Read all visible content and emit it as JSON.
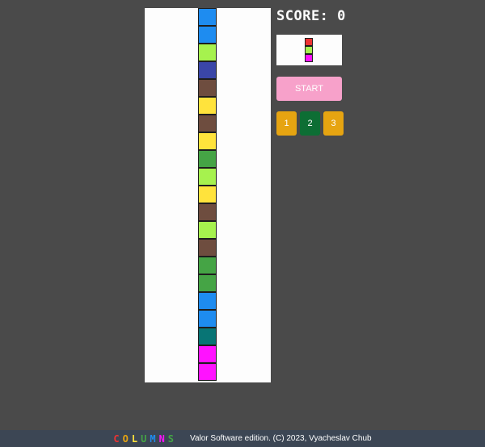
{
  "board": {
    "column": [
      "blue",
      "blue",
      "lime",
      "indigo",
      "brown",
      "yellow",
      "brown",
      "yellow",
      "green",
      "lime",
      "yellow",
      "brown",
      "lime",
      "brown",
      "green",
      "green",
      "blue",
      "blue",
      "teal",
      "magenta",
      "magenta"
    ]
  },
  "palette": {
    "blue": "#1e8cf0",
    "lime": "#a6f24e",
    "indigo": "#3a46a8",
    "brown": "#6e4d3f",
    "yellow": "#ffe33c",
    "green": "#45a445",
    "teal": "#087575",
    "magenta": "#ff12ff",
    "red": "#ee3333"
  },
  "score": {
    "label": "SCORE: 0"
  },
  "next_piece": [
    "red",
    "lime",
    "magenta"
  ],
  "controls": {
    "start_label": "START",
    "start_color": "#f7a1ca",
    "levels": [
      {
        "label": "1",
        "color": "#e6a411"
      },
      {
        "label": "2",
        "color": "#0d6e34"
      },
      {
        "label": "3",
        "color": "#e6a411"
      }
    ]
  },
  "footer": {
    "logo_letters": [
      "C",
      "O",
      "L",
      "U",
      "M",
      "N",
      "S"
    ],
    "logo_colors": [
      "#ee3333",
      "#e6a411",
      "#ffe33c",
      "#45a445",
      "#1e8cf0",
      "#ff12ff",
      "#45a445"
    ],
    "credit": "Valor Software edition. (C) 2023, Vyacheslav Chub"
  }
}
